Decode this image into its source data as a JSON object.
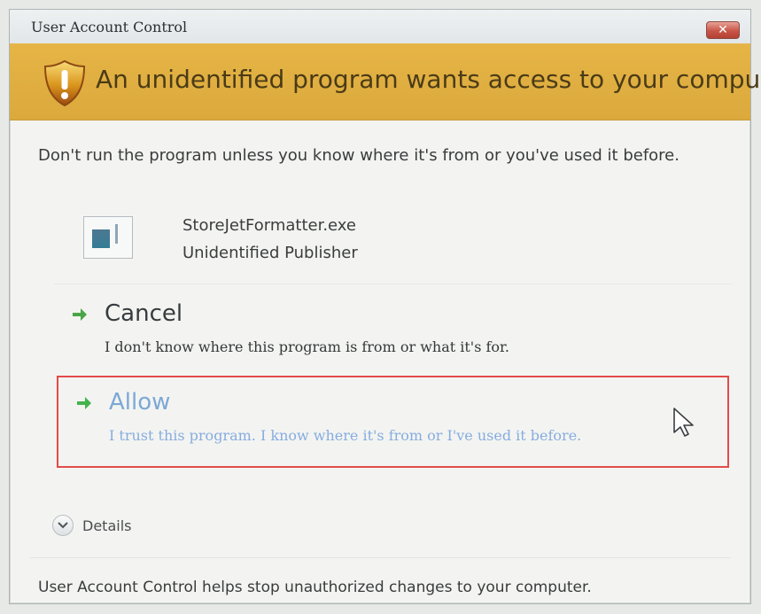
{
  "window": {
    "title": "User Account Control",
    "close_label": "✕"
  },
  "banner": {
    "heading": "An unidentified program wants access to your computer",
    "icon": "shield-warning-icon",
    "color": "#dfae40"
  },
  "warning_text": "Don't run the program unless you know where it's from or you've used it before.",
  "program": {
    "name": "StoreJetFormatter.exe",
    "publisher": "Unidentified Publisher",
    "icon": "program-file-icon"
  },
  "options": {
    "cancel": {
      "title": "Cancel",
      "description": "I don't know where this program is from or what it's for.",
      "icon": "green-arrow-icon"
    },
    "allow": {
      "title": "Allow",
      "description": "I trust this program. I know where it's from or I've used it before.",
      "icon": "green-arrow-icon",
      "highlight_color": "#e34a4a"
    }
  },
  "details": {
    "label": "Details",
    "icon": "chevron-down-icon"
  },
  "footer": "User Account Control helps stop unauthorized changes to your computer."
}
